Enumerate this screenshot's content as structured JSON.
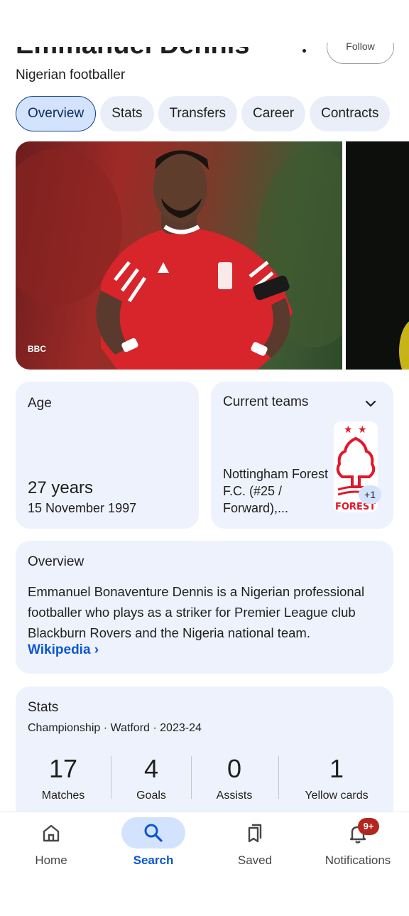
{
  "header": {
    "name": "Emmanuel Dennis",
    "subtitle": "Nigerian footballer",
    "follow_label": "Follow"
  },
  "tabs": [
    {
      "label": "Overview",
      "active": true
    },
    {
      "label": "Stats"
    },
    {
      "label": "Transfers"
    },
    {
      "label": "Career"
    },
    {
      "label": "Contracts"
    }
  ],
  "images": {
    "credit": "BBC"
  },
  "age_card": {
    "label": "Age",
    "value": "27 years",
    "date": "15 November 1997"
  },
  "teams_card": {
    "label": "Current teams",
    "team_text": "Nottingham Forest F.C. (#25 / Forward),...",
    "extra_count": "+1",
    "crest_text": "FOREST"
  },
  "overview_card": {
    "label": "Overview",
    "text": "Emmanuel Bonaventure Dennis is a Nigerian professional footballer who plays as a striker for Premier League club Blackburn Rovers and the Nigeria national team.",
    "source": "Wikipedia",
    "source_arrow": "›"
  },
  "stats_card": {
    "label": "Stats",
    "subtitle": "Championship · Watford · 2023-24",
    "items": [
      {
        "value": "17",
        "label": "Matches"
      },
      {
        "value": "4",
        "label": "Goals"
      },
      {
        "value": "0",
        "label": "Assists"
      },
      {
        "value": "1",
        "label": "Yellow cards"
      }
    ]
  },
  "bottom_nav": {
    "items": [
      {
        "label": "Home",
        "icon": "home-icon"
      },
      {
        "label": "Search",
        "icon": "search-icon",
        "active": true
      },
      {
        "label": "Saved",
        "icon": "bookmarks-icon"
      },
      {
        "label": "Notifications",
        "icon": "bell-icon"
      }
    ],
    "notification_badge": "9+"
  },
  "colors": {
    "accent": "#0b57d0",
    "card_bg": "#eef2fc",
    "active_pill": "#d3e3fd",
    "badge": "#b3261e"
  }
}
